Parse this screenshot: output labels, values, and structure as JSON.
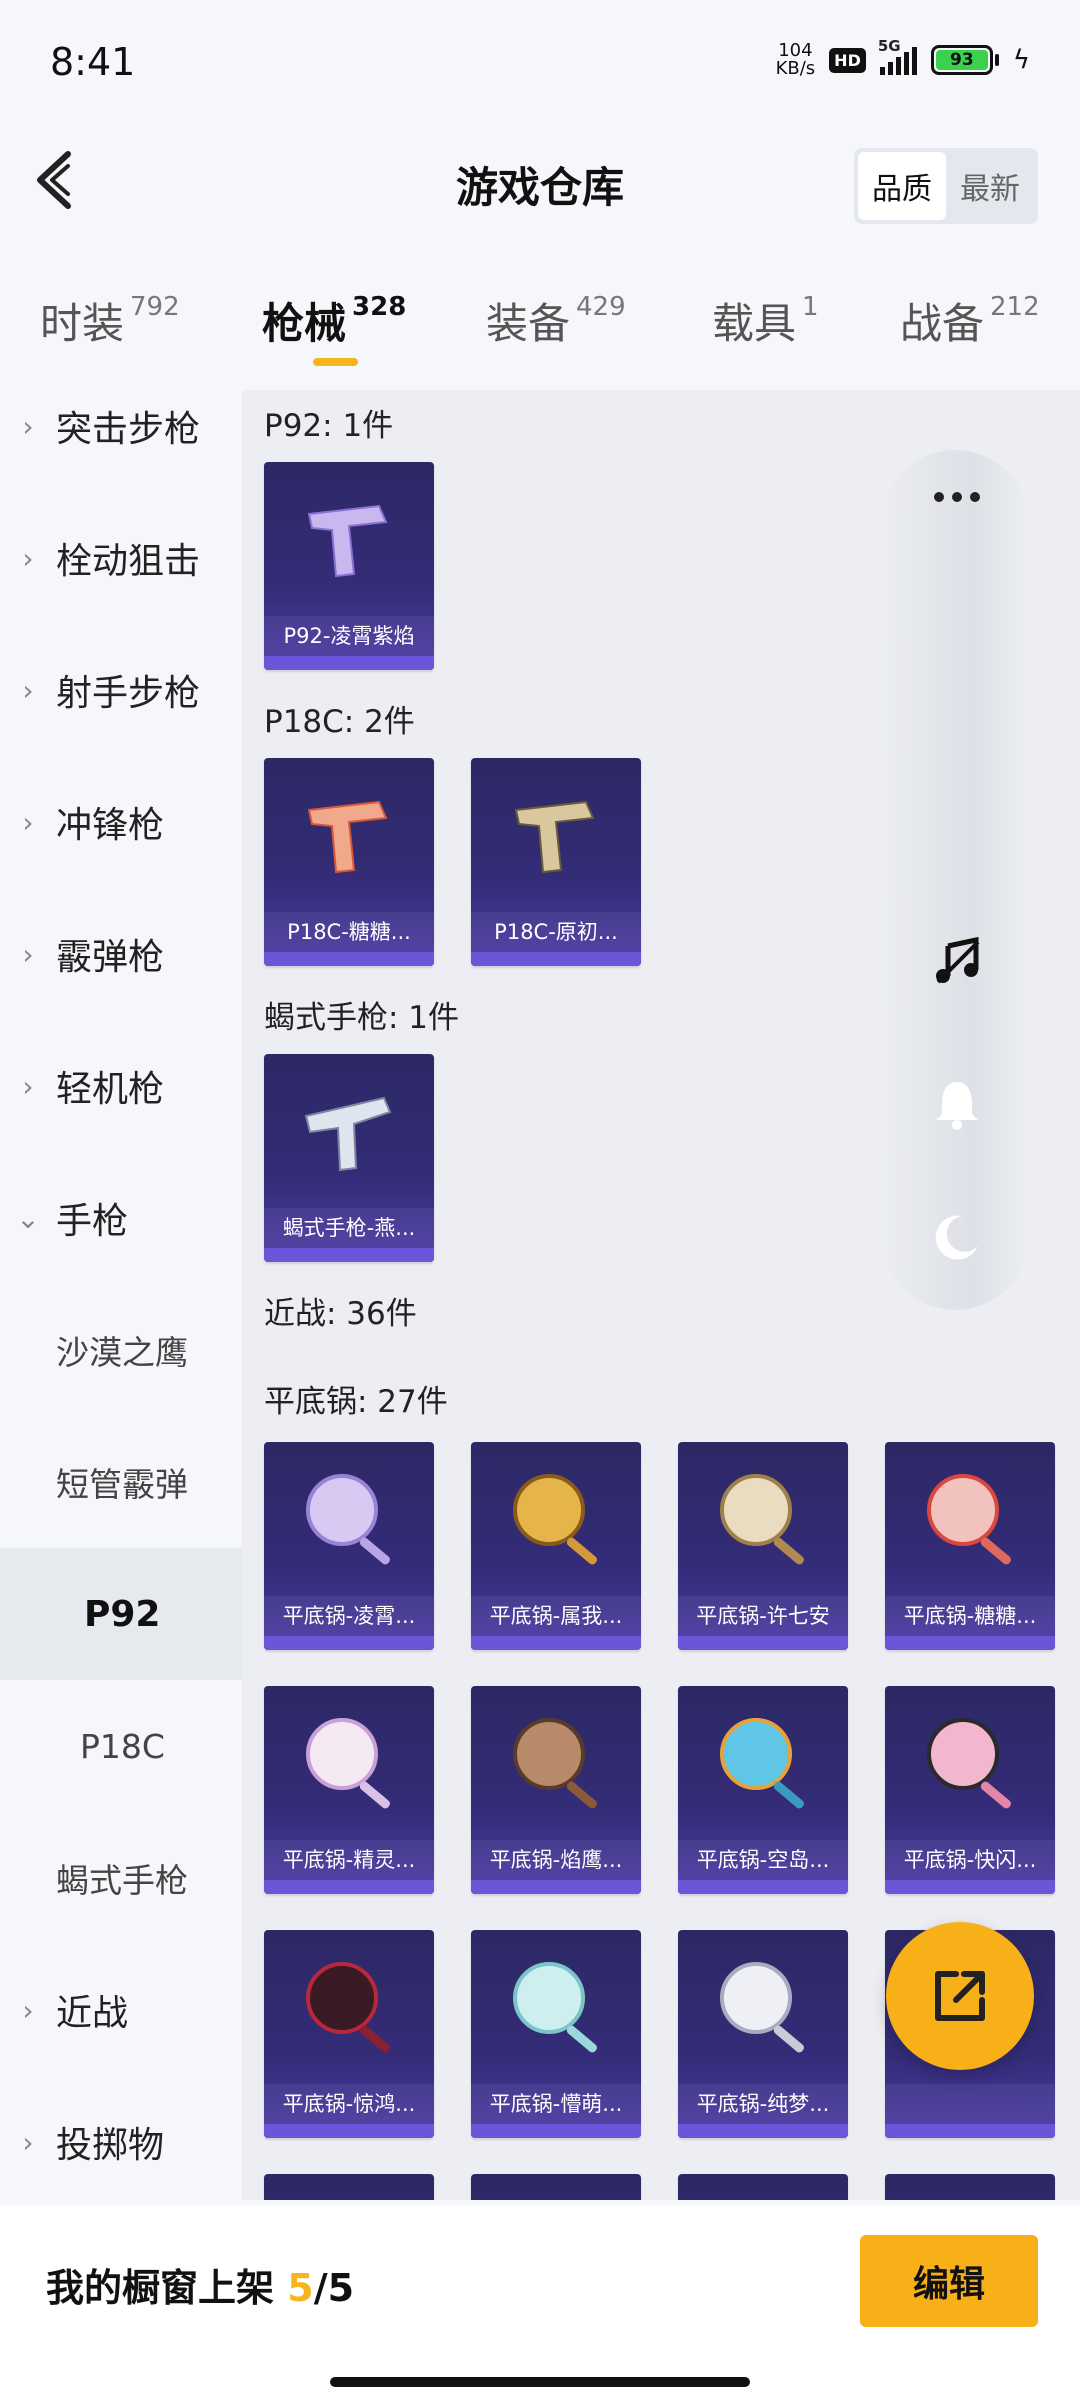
{
  "status": {
    "time": "8:41",
    "net_speed_value": "104",
    "net_speed_unit": "KB/s",
    "hd": "HD",
    "network": "5G",
    "battery": "93"
  },
  "header": {
    "title": "游戏仓库",
    "sort_options": [
      "品质",
      "最新"
    ]
  },
  "tabs": [
    {
      "label": "时装",
      "count": "792"
    },
    {
      "label": "枪械",
      "count": "328"
    },
    {
      "label": "装备",
      "count": "429"
    },
    {
      "label": "载具",
      "count": "1"
    },
    {
      "label": "战备",
      "count": "212"
    }
  ],
  "sidebar": {
    "items": [
      {
        "label": "突击步枪"
      },
      {
        "label": "栓动狙击"
      },
      {
        "label": "射手步枪"
      },
      {
        "label": "冲锋枪"
      },
      {
        "label": "霰弹枪"
      },
      {
        "label": "轻机枪"
      },
      {
        "label": "手枪"
      },
      {
        "label": "沙漠之鹰"
      },
      {
        "label": "短管霰弹"
      },
      {
        "label": "P92"
      },
      {
        "label": "P18C"
      },
      {
        "label": "蝎式手枪"
      },
      {
        "label": "近战"
      },
      {
        "label": "投掷物"
      }
    ]
  },
  "sections": {
    "p92": "P92: 1件",
    "p18c": "P18C: 2件",
    "scorpion": "蝎式手枪: 1件",
    "melee": "近战: 36件",
    "pan": "平底锅: 27件"
  },
  "cards": {
    "p92": [
      "P92-凌霄紫焰"
    ],
    "p18c": [
      "P18C-糖糖...",
      "P18C-原初..."
    ],
    "scorpion": [
      "蝎式手枪-燕..."
    ],
    "pan": [
      "平底锅-凌霄...",
      "平底锅-属我...",
      "平底锅-许七安",
      "平底锅-糖糖...",
      "平底锅-精灵...",
      "平底锅-焰鹰...",
      "平底锅-空岛...",
      "平底锅-快闪...",
      "平底锅-惊鸿...",
      "平底锅-懵萌...",
      "平底锅-纯梦...",
      ""
    ]
  },
  "bottom": {
    "showcase_label": "我的橱窗上架 ",
    "current": "5",
    "sep": "/",
    "total": "5",
    "edit_label": "编辑"
  },
  "colors": {
    "accent": "#f8b019",
    "card_top": "#2c2864",
    "card_bottom": "#6a56d8"
  }
}
